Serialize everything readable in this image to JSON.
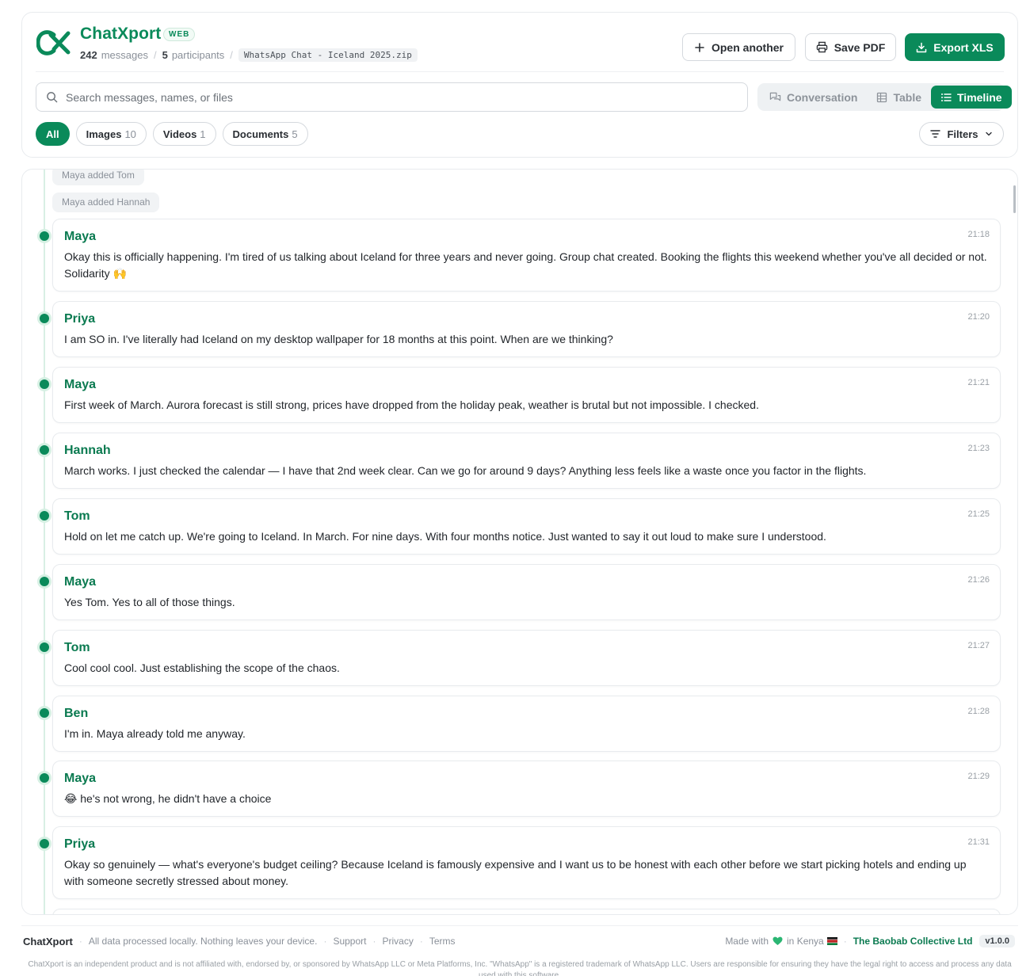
{
  "header": {
    "app_title": "ChatXport",
    "badge": "WEB",
    "messages_count": "242",
    "messages_label": "messages",
    "participants_count": "5",
    "participants_label": "participants",
    "file_name": "WhatsApp Chat - Iceland 2025.zip",
    "open_another_label": "Open another",
    "save_pdf_label": "Save PDF",
    "export_xls_label": "Export XLS",
    "brand_color": "#0a8a5a"
  },
  "search": {
    "placeholder": "Search messages, names, or files",
    "value": ""
  },
  "views": {
    "conversation": "Conversation",
    "table": "Table",
    "timeline": "Timeline",
    "active": "Timeline"
  },
  "filters": {
    "chips": [
      {
        "label": "All",
        "count": ""
      },
      {
        "label": "Images",
        "count": "10"
      },
      {
        "label": "Videos",
        "count": "1"
      },
      {
        "label": "Documents",
        "count": "5"
      }
    ],
    "filters_label": "Filters"
  },
  "timeline": {
    "system_events": [
      "Maya added Tom",
      "Maya added Hannah"
    ],
    "messages": [
      {
        "sender": "Maya",
        "time": "21:18",
        "text": "Okay this is officially happening. I'm tired of us talking about Iceland for three years and never going. Group chat created. Booking the flights this weekend whether you've all decided or not. Solidarity 🙌"
      },
      {
        "sender": "Priya",
        "time": "21:20",
        "text": "I am SO in. I've literally had Iceland on my desktop wallpaper for 18 months at this point. When are we thinking?"
      },
      {
        "sender": "Maya",
        "time": "21:21",
        "text": "First week of March. Aurora forecast is still strong, prices have dropped from the holiday peak, weather is brutal but not impossible. I checked."
      },
      {
        "sender": "Hannah",
        "time": "21:23",
        "text": "March works. I just checked the calendar — I have that 2nd week clear. Can we go for around 9 days? Anything less feels like a waste once you factor in the flights."
      },
      {
        "sender": "Tom",
        "time": "21:25",
        "text": "Hold on let me catch up. We're going to Iceland. In March. For nine days. With four months notice. Just wanted to say it out loud to make sure I understood."
      },
      {
        "sender": "Maya",
        "time": "21:26",
        "text": "Yes Tom. Yes to all of those things."
      },
      {
        "sender": "Tom",
        "time": "21:27",
        "text": "Cool cool cool. Just establishing the scope of the chaos."
      },
      {
        "sender": "Ben",
        "time": "21:28",
        "text": "I'm in. Maya already told me anyway."
      },
      {
        "sender": "Maya",
        "time": "21:29",
        "text": "😂 he's not wrong, he didn't have a choice"
      },
      {
        "sender": "Priya",
        "time": "21:31",
        "text": "Okay so genuinely — what's everyone's budget ceiling? Because Iceland is famously expensive and I want us to be honest with each other before we start picking hotels and ending up with someone secretly stressed about money."
      }
    ]
  },
  "footer": {
    "brand": "ChatXport",
    "tagline": "All data processed locally. Nothing leaves your device.",
    "support": "Support",
    "privacy": "Privacy",
    "terms": "Terms",
    "made_with": "Made with",
    "in_kenya": "in Kenya",
    "company": "The Baobab Collective Ltd",
    "version": "v1.0.0",
    "disclaimer": "ChatXport is an independent product and is not affiliated with, endorsed by, or sponsored by WhatsApp LLC or Meta Platforms, Inc. \"WhatsApp\" is a registered trademark of WhatsApp LLC. Users are responsible for ensuring they have the legal right to access and process any data used with this software."
  }
}
